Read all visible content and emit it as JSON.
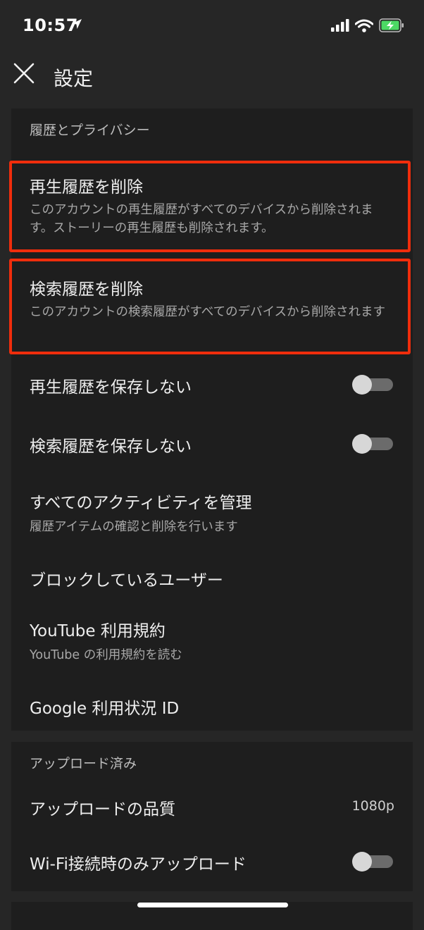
{
  "status_bar": {
    "time": "10:57"
  },
  "header": {
    "title": "設定"
  },
  "privacy_section": {
    "title": "履歴とプライバシー",
    "clear_watch": {
      "title": "再生履歴を削除",
      "subtitle": "このアカウントの再生履歴がすべてのデバイスから削除されます。ストーリーの再生履歴も削除されます。"
    },
    "clear_search": {
      "title": "検索履歴を削除",
      "subtitle": "このアカウントの検索履歴がすべてのデバイスから削除されます"
    },
    "pause_watch": {
      "title": "再生履歴を保存しない",
      "on": false
    },
    "pause_search": {
      "title": "検索履歴を保存しない",
      "on": false
    },
    "manage_activity": {
      "title": "すべてのアクティビティを管理",
      "subtitle": "履歴アイテムの確認と削除を行います"
    },
    "blocked_users": {
      "title": "ブロックしているユーザー"
    },
    "terms": {
      "title": "YouTube 利用規約",
      "subtitle": "YouTube の利用規約を読む"
    },
    "usage_id": {
      "title": "Google 利用状況 ID"
    }
  },
  "uploads_section": {
    "title": "アップロード済み",
    "quality": {
      "title": "アップロードの品質",
      "value": "1080p"
    },
    "wifi_only": {
      "title": "Wi-Fi接続時のみアップロード",
      "on": false
    }
  },
  "colors": {
    "highlight": "#f02d0c",
    "card": "#1e1e1e",
    "background": "#262626",
    "battery": "#4cd964"
  },
  "icons": [
    "location-arrow-icon",
    "cellular-signal-icon",
    "wifi-icon",
    "battery-charging-icon",
    "close-icon"
  ]
}
